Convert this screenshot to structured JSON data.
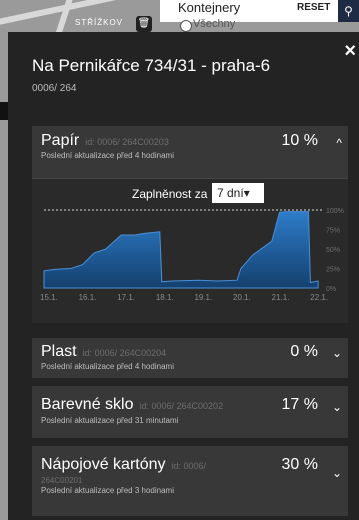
{
  "map": {
    "street_label": "STŘÍŽKOV"
  },
  "filter": {
    "title": "Kontejnery",
    "option_all": "Všechny",
    "reset_label": "RESET"
  },
  "panel": {
    "title": "Na Pernikářce 734/31 - praha-6",
    "subtitle": "0006/ 264",
    "close_label": "×"
  },
  "containers": [
    {
      "name": "Papír",
      "id_text": "id: 0006/ 264C00203",
      "updated": "Poslední aktualizace před 4 hodinami",
      "percent": "10 %",
      "expanded": true,
      "chevron": "^"
    },
    {
      "name": "Plast",
      "id_text": "id: 0006/ 264C00204",
      "updated": "Poslední aktualizace před 4 hodinami",
      "percent": "0 %",
      "chevron": "⌄"
    },
    {
      "name": "Barevné sklo",
      "id_text": "id: 0006/ 264C00202",
      "updated": "Poslední aktualizace před 31 minutami",
      "percent": "17 %",
      "chevron": "⌄"
    },
    {
      "name": "Nápojové kartóny",
      "id_text": "id: 0006/",
      "id_text_2": "264C00201",
      "updated": "Poslední aktualizace před 3 hodinami",
      "percent": "30 %",
      "chevron": "⌄"
    }
  ],
  "chart_controls": {
    "label": "Zaplněnost za",
    "period": "7 dní"
  },
  "chart_data": {
    "type": "area",
    "title": "",
    "xlabel": "",
    "ylabel": "",
    "x_ticks": [
      "15.1.",
      "16.1.",
      "17.1.",
      "18.1.",
      "19.1.",
      "20.1.",
      "21.1.",
      "22.1."
    ],
    "y_ticks": [
      "100%",
      "75%",
      "50%",
      "25%",
      "0%"
    ],
    "ylim": [
      0,
      100
    ],
    "xlim": [
      0,
      7.2
    ],
    "series": [
      {
        "color": "#1e5fa3",
        "points": [
          [
            0.0,
            22
          ],
          [
            0.3,
            24
          ],
          [
            0.7,
            25
          ],
          [
            1.0,
            30
          ],
          [
            1.3,
            45
          ],
          [
            1.6,
            50
          ],
          [
            2.0,
            68
          ],
          [
            2.35,
            68
          ],
          [
            2.6,
            70
          ],
          [
            3.0,
            72
          ],
          [
            3.05,
            8
          ],
          [
            3.3,
            9
          ],
          [
            4.0,
            10
          ],
          [
            4.5,
            9
          ],
          [
            5.0,
            10
          ],
          [
            5.1,
            25
          ],
          [
            5.4,
            42
          ],
          [
            5.9,
            60
          ],
          [
            6.1,
            97
          ],
          [
            6.3,
            98
          ],
          [
            6.85,
            98
          ],
          [
            6.9,
            7
          ],
          [
            7.1,
            9
          ]
        ]
      }
    ],
    "max_line": 100,
    "grid": false
  }
}
